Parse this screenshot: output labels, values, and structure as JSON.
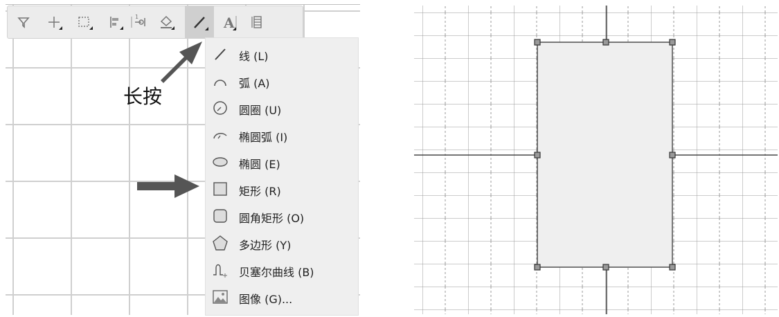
{
  "toolbar": {
    "tools": [
      {
        "icon": "filter-icon"
      },
      {
        "icon": "move-icon"
      },
      {
        "icon": "marquee-select-icon"
      },
      {
        "icon": "align-icon"
      },
      {
        "icon": "dimension-icon"
      },
      {
        "icon": "fill-icon"
      },
      {
        "icon": "line-tool-icon",
        "active": true
      },
      {
        "icon": "text-tool-icon"
      },
      {
        "icon": "layers-icon"
      }
    ]
  },
  "annotation": {
    "press_label": "长按"
  },
  "shape_menu": {
    "items": [
      {
        "icon": "line-icon",
        "label": "线 (L)"
      },
      {
        "icon": "arc-icon",
        "label": "弧 (A)"
      },
      {
        "icon": "circle-icon",
        "label": "圆圈 (U)"
      },
      {
        "icon": "ellipse-arc-icon",
        "label": "椭圆弧 (I)"
      },
      {
        "icon": "ellipse-icon",
        "label": "椭圆 (E)"
      },
      {
        "icon": "rectangle-icon",
        "label": "矩形 (R)",
        "highlighted_by_arrow": true
      },
      {
        "icon": "rounded-rectangle-icon",
        "label": "圆角矩形 (O)"
      },
      {
        "icon": "polygon-icon",
        "label": "多边形 (Y)"
      },
      {
        "icon": "bezier-curve-icon",
        "label": "贝塞尔曲线 (B)"
      },
      {
        "icon": "image-icon",
        "label": "图像 (G)..."
      }
    ]
  },
  "colors": {
    "toolbar_bg": "#ececec",
    "menu_bg": "#efefef",
    "arrow": "#555555",
    "rect_fill": "#efefef"
  }
}
